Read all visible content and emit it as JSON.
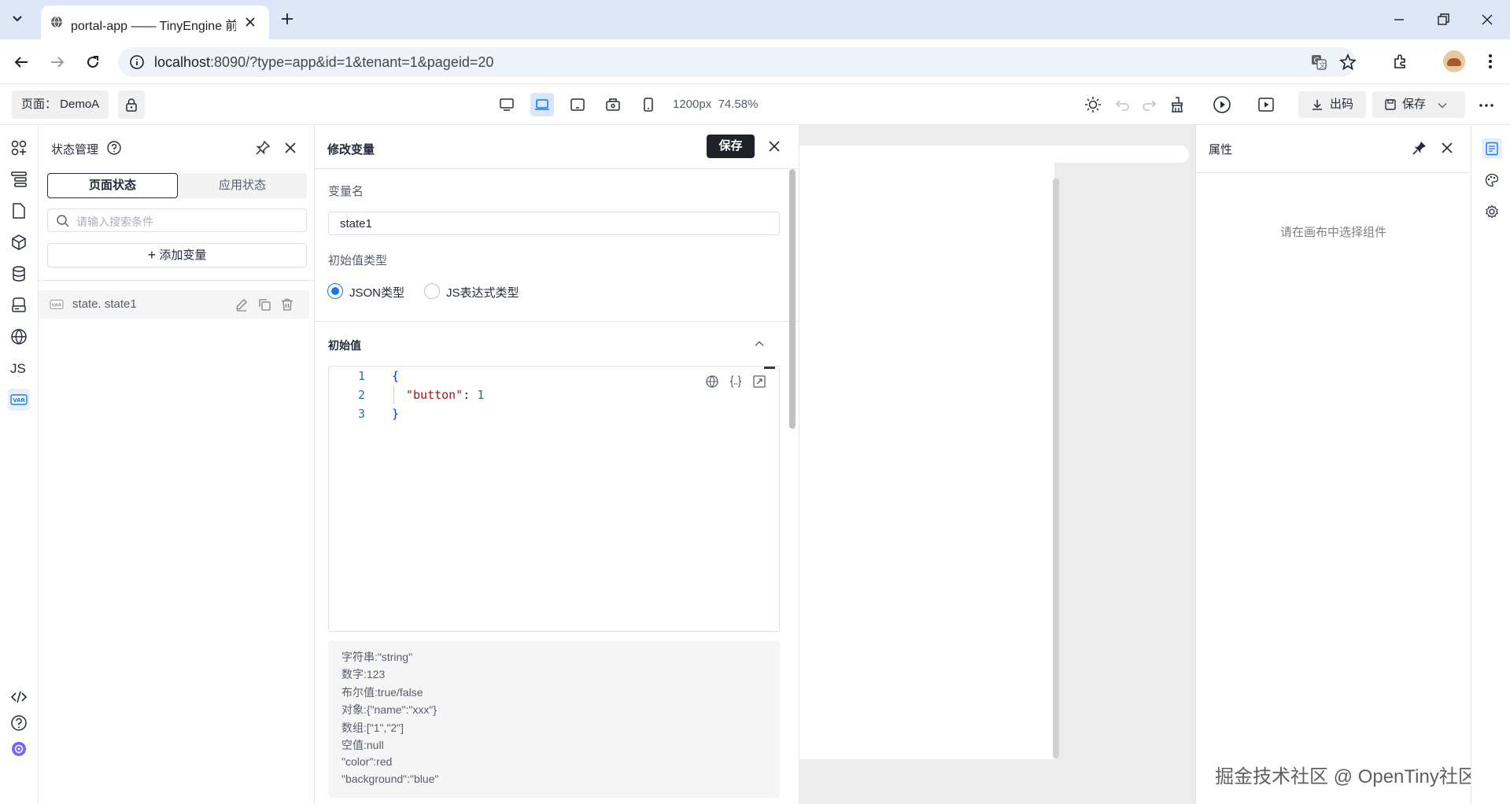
{
  "browser": {
    "tab_title": "portal-app —— TinyEngine 前端可视化设计器",
    "url_host": "localhost",
    "url_rest": ":8090/?type=app&id=1&tenant=1&pageid=20"
  },
  "toolbar": {
    "page_label": "页面：  DemoA",
    "canvas_size": "1200px",
    "zoom": "74.58%",
    "export_label": "出码",
    "save_label": "保存"
  },
  "state_panel": {
    "title": "状态管理",
    "tabs": [
      "页面状态",
      "应用状态"
    ],
    "search_placeholder": "请输入搜索条件",
    "add_label": "添加变量",
    "variables": [
      {
        "name": "state. state1"
      }
    ]
  },
  "edit_panel": {
    "title": "修改变量",
    "save_label": "保存",
    "var_name_label": "变量名",
    "var_name_value": "state1",
    "init_type_label": "初始值类型",
    "radio_options": [
      "JSON类型",
      "JS表达式类型"
    ],
    "selected_type": "JSON类型",
    "init_value_label": "初始值",
    "code_lines": [
      "1",
      "2",
      "3"
    ],
    "code": {
      "open": "{",
      "key": "\"button\"",
      "colon": ": ",
      "value": "1",
      "close": "}"
    },
    "hints": [
      "字符串:\"string\"",
      "数字:123",
      "布尔值:true/false",
      "对象:{\"name\":\"xxx\"}",
      "数组:[\"1\",\"2\"]",
      "空值:null",
      "\"color\":red",
      "\"background\":\"blue\""
    ]
  },
  "props_panel": {
    "title": "属性",
    "empty_text": "请在画布中选择组件"
  },
  "watermark": "掘金技术社区 @ OpenTiny社区",
  "colors": {
    "accent": "#1476ff",
    "dark_button": "#1f2329",
    "tab_strip": "#dde6f6"
  }
}
